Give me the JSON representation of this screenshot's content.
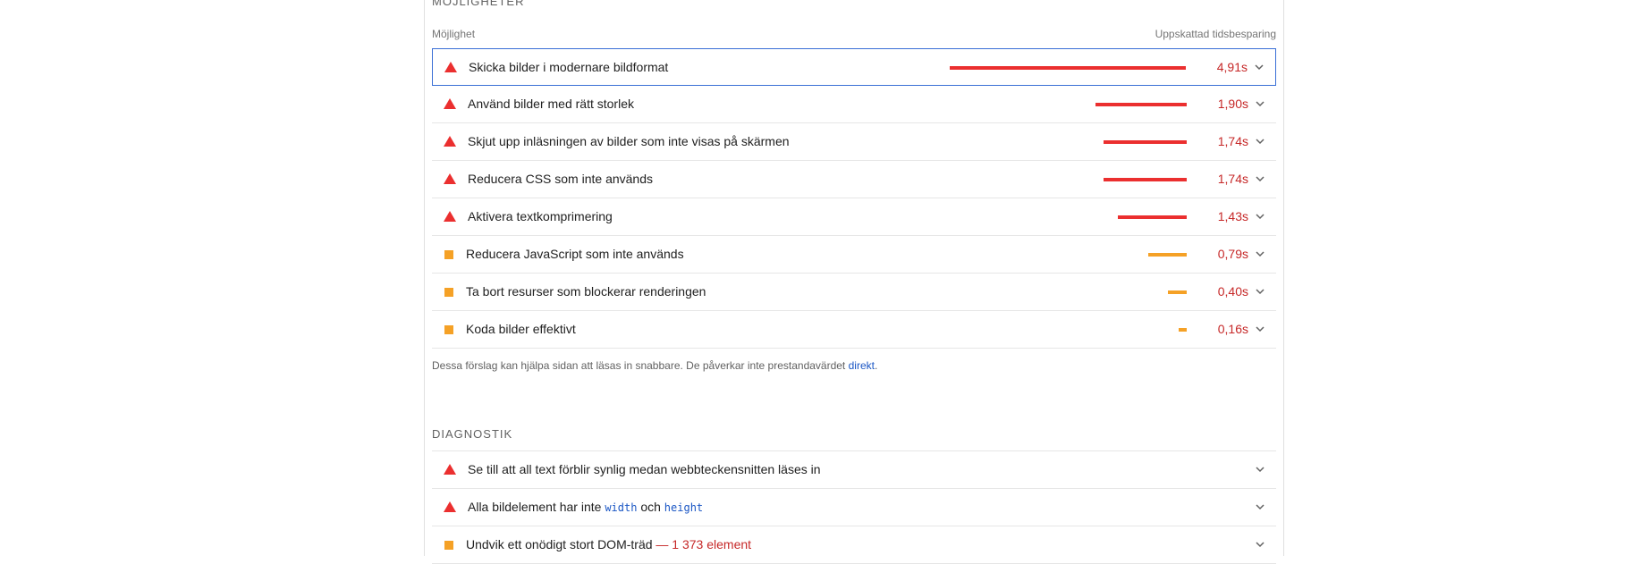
{
  "opportunities": {
    "section_title": "MÖJLIGHETER",
    "col_left": "Möjlighet",
    "col_right": "Uppskattad tidsbesparing",
    "items": [
      {
        "title": "Skicka bilder i modernare bildformat",
        "savings": "4,91s",
        "severity": "fail",
        "bar_fraction": 1.0
      },
      {
        "title": "Använd bilder med rätt storlek",
        "savings": "1,90s",
        "severity": "fail",
        "bar_fraction": 0.387
      },
      {
        "title": "Skjut upp inläsningen av bilder som inte visas på skärmen",
        "savings": "1,74s",
        "severity": "fail",
        "bar_fraction": 0.354
      },
      {
        "title": "Reducera CSS som inte används",
        "savings": "1,74s",
        "severity": "fail",
        "bar_fraction": 0.354
      },
      {
        "title": "Aktivera textkomprimering",
        "savings": "1,43s",
        "severity": "fail",
        "bar_fraction": 0.291
      },
      {
        "title": "Reducera JavaScript som inte används",
        "savings": "0,79s",
        "severity": "average",
        "bar_fraction": 0.161
      },
      {
        "title": "Ta bort resurser som blockerar renderingen",
        "savings": "0,40s",
        "severity": "average",
        "bar_fraction": 0.081
      },
      {
        "title": "Koda bilder effektivt",
        "savings": "0,16s",
        "severity": "average",
        "bar_fraction": 0.033
      }
    ],
    "footnote": "Dessa förslag kan hjälpa sidan att läsas in snabbare. De påverkar inte prestandavärdet",
    "footnote_link": "direkt",
    "footnote_end": "."
  },
  "diagnostics": {
    "section_title": "DIAGNOSTIK",
    "item1": {
      "title": "Se till att all text förblir synlig medan webbteckensnitten läses in",
      "severity": "fail"
    },
    "item2": {
      "pre": "Alla bildelement har inte",
      "code1": "width",
      "mid": "och",
      "code2": "height",
      "severity": "fail"
    },
    "item3": {
      "title": "Undvik ett onödigt stort DOM-träd",
      "extra": "— 1 373 element",
      "severity": "average"
    }
  },
  "colors": {
    "fail": "#eb2f2f",
    "average": "#f5a126",
    "savings_text": "#c62828",
    "link": "#1a56c4",
    "focus_border": "#3a6fd6"
  },
  "icons": {
    "fail": "warning-triangle-icon",
    "average": "orange-square-icon",
    "expand": "chevron-down-icon"
  }
}
